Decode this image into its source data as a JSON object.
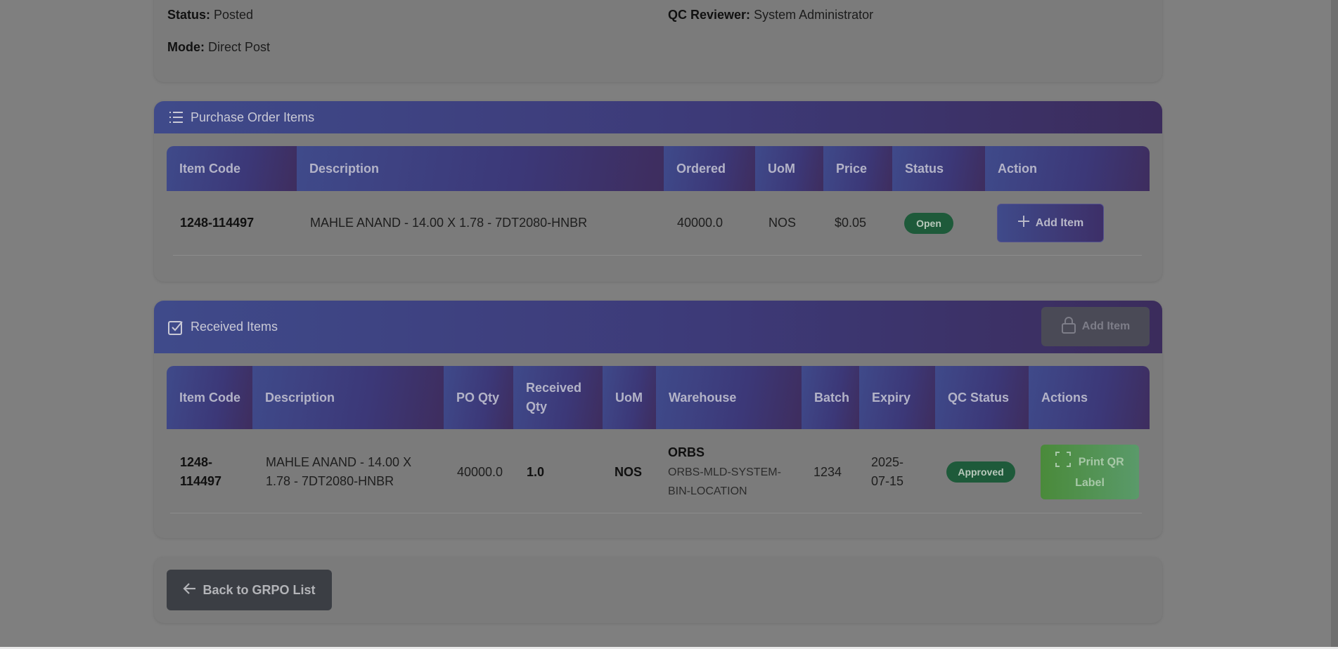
{
  "info": {
    "status_label": "Status:",
    "status_value": "Posted",
    "mode_label": "Mode:",
    "mode_value": "Direct Post",
    "qc_label": "QC Reviewer:",
    "qc_value": "System Administrator"
  },
  "po_section": {
    "title": "Purchase Order Items",
    "icon": "list-icon",
    "columns": [
      "Item Code",
      "Description",
      "Ordered",
      "UoM",
      "Price",
      "Status",
      "Action"
    ],
    "rows": [
      {
        "item_code": "1248-114497",
        "description": "MAHLE ANAND - 14.00 X 1.78 - 7DT2080-HNBR",
        "ordered": "40000.0",
        "uom": "NOS",
        "price": "$0.05",
        "status": "Open",
        "action_label": "Add Item"
      }
    ]
  },
  "received_section": {
    "title": "Received Items",
    "icon": "checkbox-icon",
    "header_button": "Add Item",
    "columns": [
      "Item Code",
      "Description",
      "PO Qty",
      "Received Qty",
      "UoM",
      "Warehouse",
      "Batch",
      "Expiry",
      "QC Status",
      "Actions"
    ],
    "rows": [
      {
        "item_code": "1248-114497",
        "description": "MAHLE ANAND - 14.00 X 1.78 - 7DT2080-HNBR",
        "po_qty": "40000.0",
        "received_qty": "1.0",
        "uom": "NOS",
        "warehouse": "ORBS",
        "bin": "ORBS-MLD-SYSTEM-BIN-LOCATION",
        "batch": "1234",
        "expiry": "2025-07-15",
        "qc_status": "Approved",
        "action_label": "Print QR Label"
      }
    ]
  },
  "footer": {
    "back_label": "Back to GRPO List"
  },
  "colors": {
    "header_gradient_start": "#3f4a8a",
    "header_gradient_end": "#3b2c5c",
    "badge_green": "#1e5a3a",
    "print_button": "#4a8a3a",
    "back_button": "#3b3e44"
  }
}
